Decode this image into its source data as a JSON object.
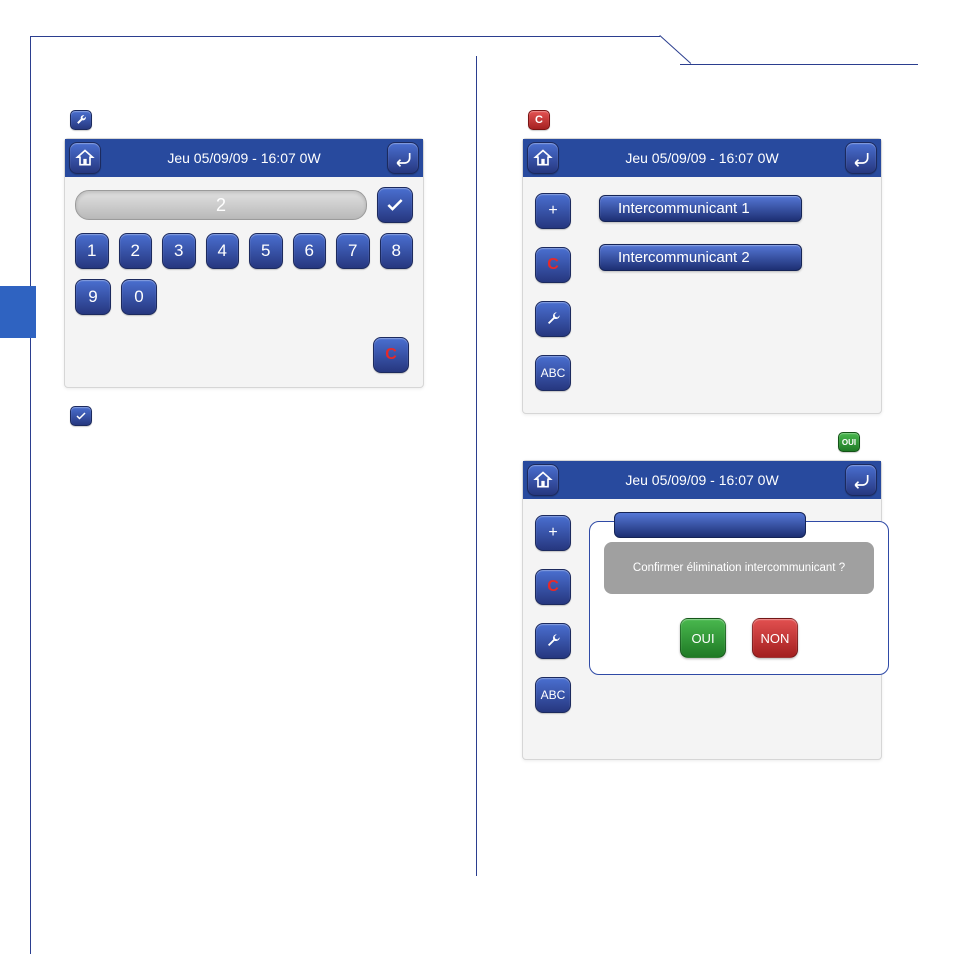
{
  "titlebar_text": "Jeu 05/09/09 - 16:07   0W",
  "left": {
    "step1_icon_glyph": "wrench",
    "keypad": {
      "field_value": "2",
      "digits_row1": [
        "1",
        "2",
        "3",
        "4",
        "5",
        "6",
        "7",
        "8"
      ],
      "digits_row2": [
        "9",
        "0"
      ],
      "clear_label": "C"
    },
    "step2_icon_glyph": "check"
  },
  "right": {
    "step1_icon_glyph": "C",
    "intercoms": {
      "items": [
        "Intercommunicant 1",
        "Intercommunicant 2"
      ],
      "side_buttons": {
        "add": "+",
        "delete": "C",
        "tools": "wrench",
        "abc": "ABC"
      }
    },
    "step2_icon_label": "OUI",
    "confirm": {
      "message": "Confirmer élimination intercommunicant ?",
      "yes": "OUI",
      "no": "NON"
    }
  }
}
